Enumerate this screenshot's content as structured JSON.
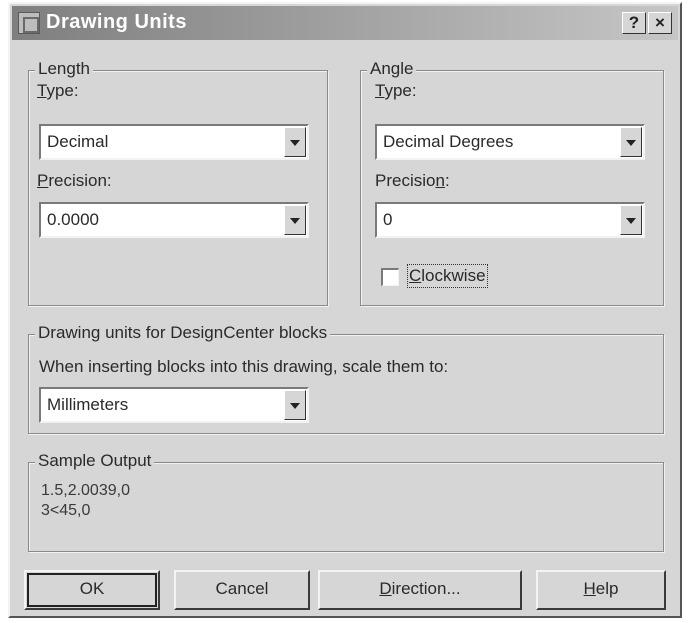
{
  "window": {
    "title": "Drawing Units",
    "help_glyph": "?",
    "close_glyph": "×"
  },
  "length": {
    "legend": "Length",
    "type_label_underlined": "T",
    "type_label_rest": "ype:",
    "type_value": "Decimal",
    "precision_label_underlined": "P",
    "precision_label_rest": "recision:",
    "precision_value": "0.0000"
  },
  "angle": {
    "legend": "Angle",
    "type_label_underlined": "T",
    "type_label_rest": "ype:",
    "type_value": "Decimal Degrees",
    "precision_label_prefix": "Precisio",
    "precision_label_underlined": "n",
    "precision_label_suffix": ":",
    "precision_value": "0",
    "clockwise_label_underlined": "C",
    "clockwise_label_rest": "lockwise",
    "clockwise_checked": false
  },
  "designcenter": {
    "legend": "Drawing units for DesignCenter blocks",
    "description": "When inserting blocks into this drawing, scale them to:",
    "units_value": "Millimeters"
  },
  "sample": {
    "legend": "Sample Output",
    "line1": "1.5,2.0039,0",
    "line2": "3<45,0"
  },
  "buttons": {
    "ok": "OK",
    "cancel": "Cancel",
    "direction_underlined": "D",
    "direction_rest": "irection...",
    "help_underlined": "H",
    "help_rest": "elp"
  },
  "icons": {
    "title_icon": "drawing-units-icon",
    "dropdown_icon": "chevron-down-icon"
  }
}
